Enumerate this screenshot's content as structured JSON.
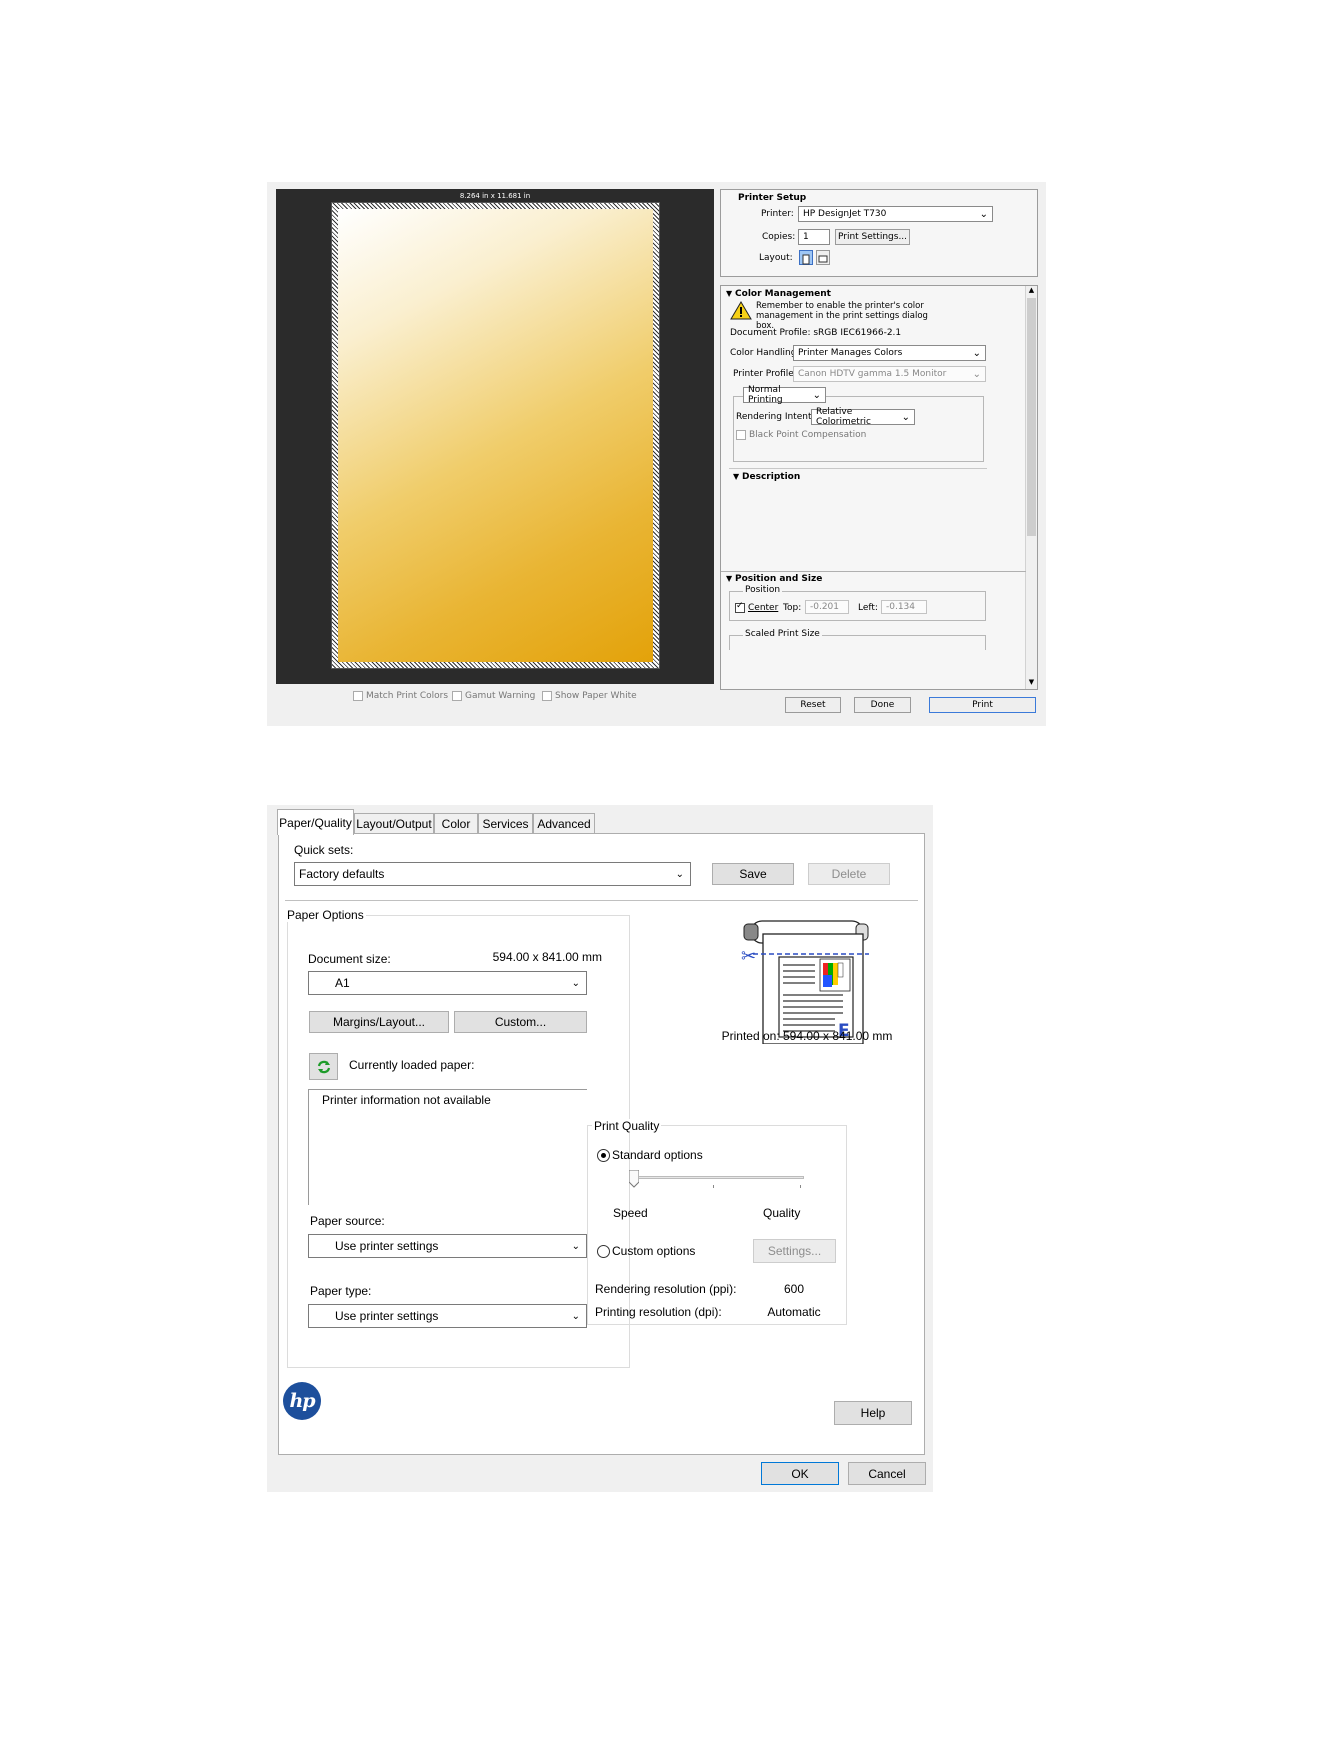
{
  "print_dialog": {
    "preview": {
      "paper_size_label": "8.264 in x 11.681 in",
      "checks": [
        "Match Print Colors",
        "Gamut Warning",
        "Show Paper White"
      ]
    },
    "printer_setup": {
      "title": "Printer Setup",
      "printer_label": "Printer:",
      "printer_value": "HP DesignJet T730",
      "copies_label": "Copies:",
      "copies_value": "1",
      "print_settings_button": "Print Settings...",
      "layout_label": "Layout:"
    },
    "color_management": {
      "title": "Color Management",
      "warning": "Remember to enable the printer's color management in the print settings dialog box.",
      "document_profile": "Document Profile: sRGB IEC61966-2.1",
      "color_handling_label": "Color Handling:",
      "color_handling_value": "Printer Manages Colors",
      "printer_profile_label": "Printer Profile:",
      "printer_profile_value": "Canon HDTV gamma 1.5 Monitor",
      "printing_mode": "Normal Printing",
      "rendering_intent_label": "Rendering Intent:",
      "rendering_intent_value": "Relative Colorimetric",
      "black_point": "Black Point Compensation"
    },
    "description": {
      "title": "Description"
    },
    "position_size": {
      "title": "Position and Size",
      "position_group": "Position",
      "center_label": "Center",
      "top_label": "Top:",
      "top_value": "-0.201",
      "left_label": "Left:",
      "left_value": "-0.134",
      "scaled_print_size": "Scaled Print Size"
    },
    "buttons": {
      "reset": "Reset",
      "done": "Done",
      "print": "Print"
    }
  },
  "hp_driver": {
    "tabs": [
      "Paper/Quality",
      "Layout/Output",
      "Color",
      "Services",
      "Advanced"
    ],
    "quick_sets_label": "Quick sets:",
    "quick_sets_value": "Factory defaults",
    "save_button": "Save",
    "delete_button": "Delete",
    "paper_options": {
      "title": "Paper Options",
      "document_size_label": "Document size:",
      "document_size_value": "594.00 x 841.00 mm",
      "size_select": "A1",
      "margins_button": "Margins/Layout...",
      "custom_button": "Custom...",
      "loaded_paper_label": "Currently loaded paper:",
      "printer_info": "Printer information not available",
      "paper_source_label": "Paper source:",
      "paper_source_value": "Use printer settings",
      "paper_type_label": "Paper type:",
      "paper_type_value": "Use printer settings"
    },
    "printed_on": "Printed on: 594.00 x 841.00 mm",
    "print_quality": {
      "title": "Print Quality",
      "standard_options": "Standard options",
      "speed_label": "Speed",
      "quality_label": "Quality",
      "slider_level": 0,
      "custom_options": "Custom options",
      "settings_button": "Settings...",
      "rendering_label": "Rendering resolution (ppi):",
      "rendering_value": "600",
      "printing_label": "Printing resolution (dpi):",
      "printing_value": "Automatic"
    },
    "help_button": "Help",
    "ok_button": "OK",
    "cancel_button": "Cancel",
    "colors": {
      "hp_blue": "#1d4f9c",
      "accent": "#0078d7"
    }
  }
}
